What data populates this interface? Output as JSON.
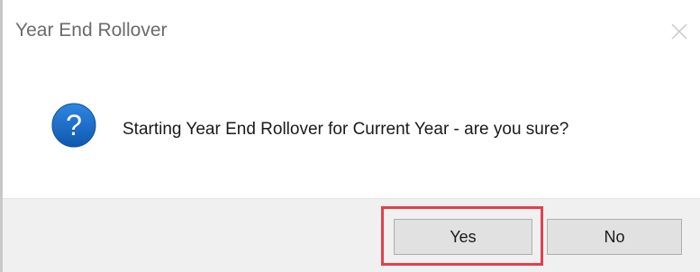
{
  "dialog": {
    "title": "Year End Rollover",
    "message": "Starting Year End Rollover for Current Year - are you sure?",
    "icon": "question-icon",
    "close_icon": "close-icon"
  },
  "buttons": {
    "yes_label": "Yes",
    "no_label": "No"
  },
  "colors": {
    "icon_blue": "#1768c4",
    "highlight_red": "#e0424a",
    "footer_bg": "#f0f0f0",
    "button_bg": "#e1e1e1"
  }
}
